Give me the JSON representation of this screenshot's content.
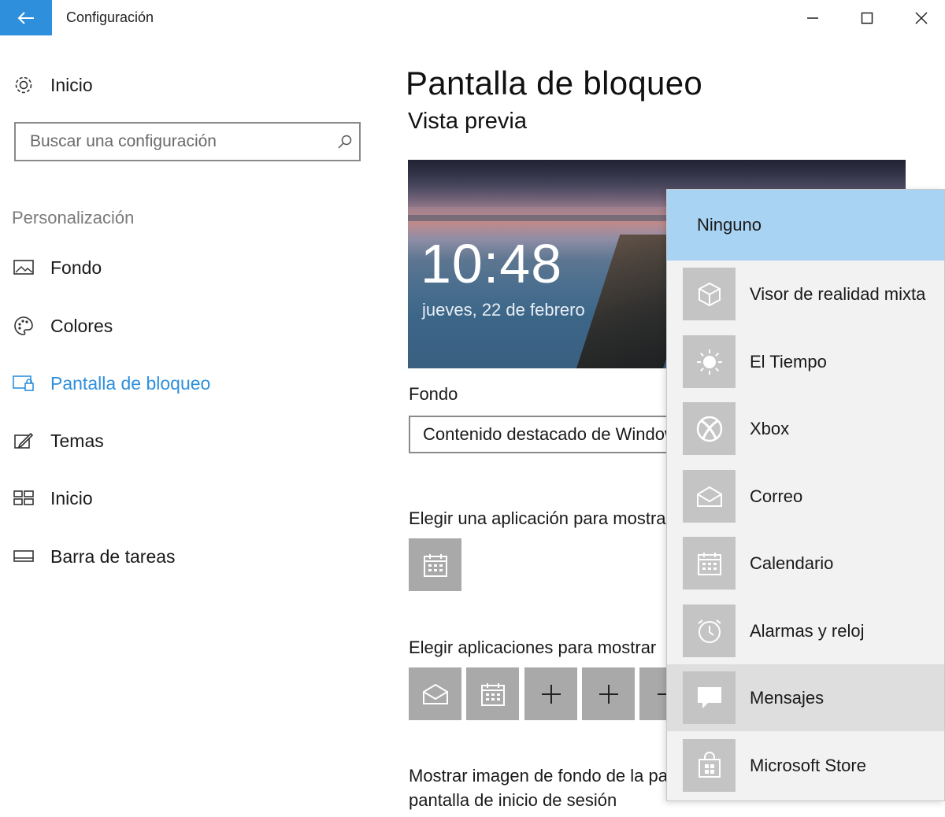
{
  "window": {
    "title": "Configuración",
    "controls": [
      "minimize",
      "maximize",
      "close"
    ]
  },
  "sidebar": {
    "home_label": "Inicio",
    "search_placeholder": "Buscar una configuración",
    "section": "Personalización",
    "items": [
      {
        "label": "Fondo",
        "icon": "picture-icon"
      },
      {
        "label": "Colores",
        "icon": "palette-icon"
      },
      {
        "label": "Pantalla de bloqueo",
        "icon": "lock-screen-icon",
        "active": true
      },
      {
        "label": "Temas",
        "icon": "brush-icon"
      },
      {
        "label": "Inicio",
        "icon": "start-icon"
      },
      {
        "label": "Barra de tareas",
        "icon": "taskbar-icon"
      }
    ]
  },
  "main": {
    "title": "Pantalla de bloqueo",
    "preview_heading": "Vista previa",
    "preview": {
      "time": "10:48",
      "date": "jueves, 22 de febrero"
    },
    "background_label": "Fondo",
    "background_value": "Contenido destacado de Windows",
    "detailed_status_label": "Elegir una aplicación para mostrar",
    "quick_status_label": "Elegir aplicaciones para mostrar",
    "signin_text_1": "Mostrar imagen de fondo de la pantalla de bloqueo en la",
    "signin_text_2": "pantalla de inicio de sesión"
  },
  "flyout": {
    "none_label": "Ninguno",
    "items": [
      {
        "label": "Visor de realidad mixta",
        "icon": "cube-icon"
      },
      {
        "label": "El Tiempo",
        "icon": "sun-icon"
      },
      {
        "label": "Xbox",
        "icon": "xbox-icon"
      },
      {
        "label": "Correo",
        "icon": "mail-icon"
      },
      {
        "label": "Calendario",
        "icon": "calendar-icon"
      },
      {
        "label": "Alarmas y reloj",
        "icon": "alarm-icon"
      },
      {
        "label": "Mensajes",
        "icon": "message-icon",
        "hover": true
      },
      {
        "label": "Microsoft Store",
        "icon": "store-icon"
      }
    ]
  },
  "colors": {
    "accent": "#2e8fdc",
    "flyout_selected": "#a9d3f3",
    "tile": "#a9a9a9"
  }
}
